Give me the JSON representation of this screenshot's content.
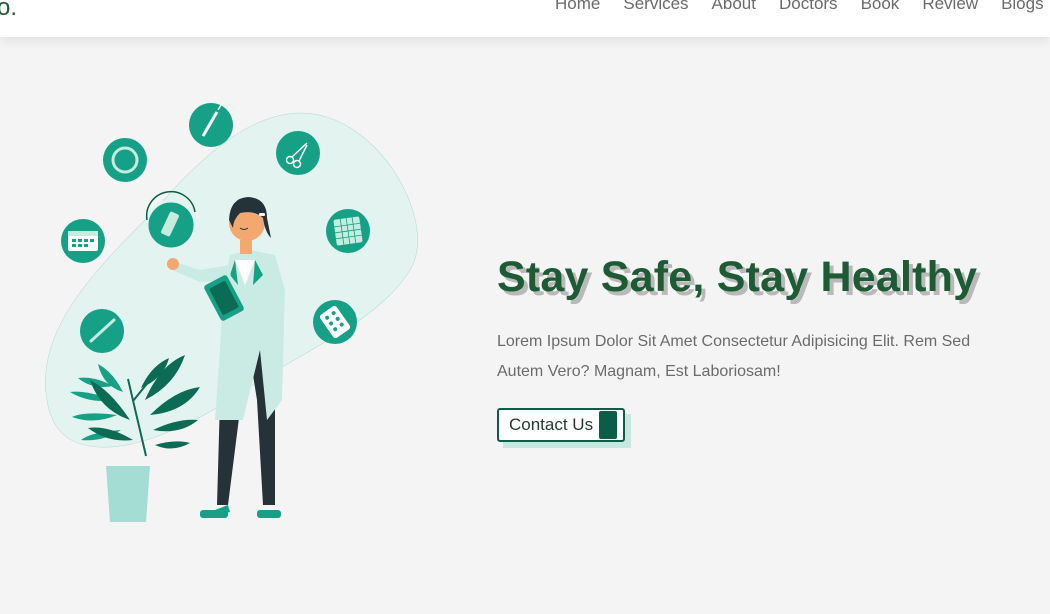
{
  "nav": {
    "logo_text": "o.",
    "links": [
      "Home",
      "Services",
      "About",
      "Doctors",
      "Book",
      "Review",
      "Blogs"
    ]
  },
  "hero": {
    "title": "Stay Safe, Stay Healthy",
    "description": "Lorem Ipsum Dolor Sit Amet Consectetur Adipisicing Elit. Rem Sed Autem Vero? Magnam, Est Laboriosam!",
    "cta_label": "Contact Us"
  },
  "colors": {
    "brand_green": "#1d5b34",
    "accent_teal": "#16a085",
    "dark_teal": "#0b5e45",
    "blob": "#e3f4f0",
    "background": "#f4f4f4"
  },
  "illustration": {
    "icons": [
      "syringe-icon",
      "scissors-icon",
      "pill-pack-icon",
      "pill-blister-icon",
      "thermometer-icon",
      "calendar-icon",
      "bandage-roll-icon",
      "inhaler-icon"
    ]
  }
}
